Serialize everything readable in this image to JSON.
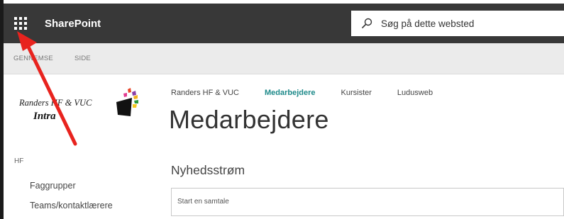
{
  "suite_bar": {
    "app_name": "SharePoint",
    "search_placeholder": "Søg på dette websted",
    "background_color": "#383838"
  },
  "command_bar": {
    "items": [
      "GENNEMSE",
      "SIDE"
    ]
  },
  "site_logo": {
    "line1": "Randers HF & VUC",
    "line2": "Intra"
  },
  "left_nav": {
    "heading": "HF",
    "items": [
      "Faggrupper",
      "Teams/kontaktlærere"
    ]
  },
  "hub_nav": {
    "items": [
      "Randers HF & VUC",
      "Medarbejdere",
      "Kursister",
      "Ludusweb"
    ],
    "active_index": 1,
    "active_color": "#1e8a8a"
  },
  "page": {
    "title": "Medarbejdere"
  },
  "newsfeed": {
    "title": "Nyhedsstrøm",
    "input_placeholder": "Start en samtale"
  },
  "annotation": {
    "arrow_color": "#e8231e",
    "points_to": "app-launcher-waffle-icon"
  }
}
